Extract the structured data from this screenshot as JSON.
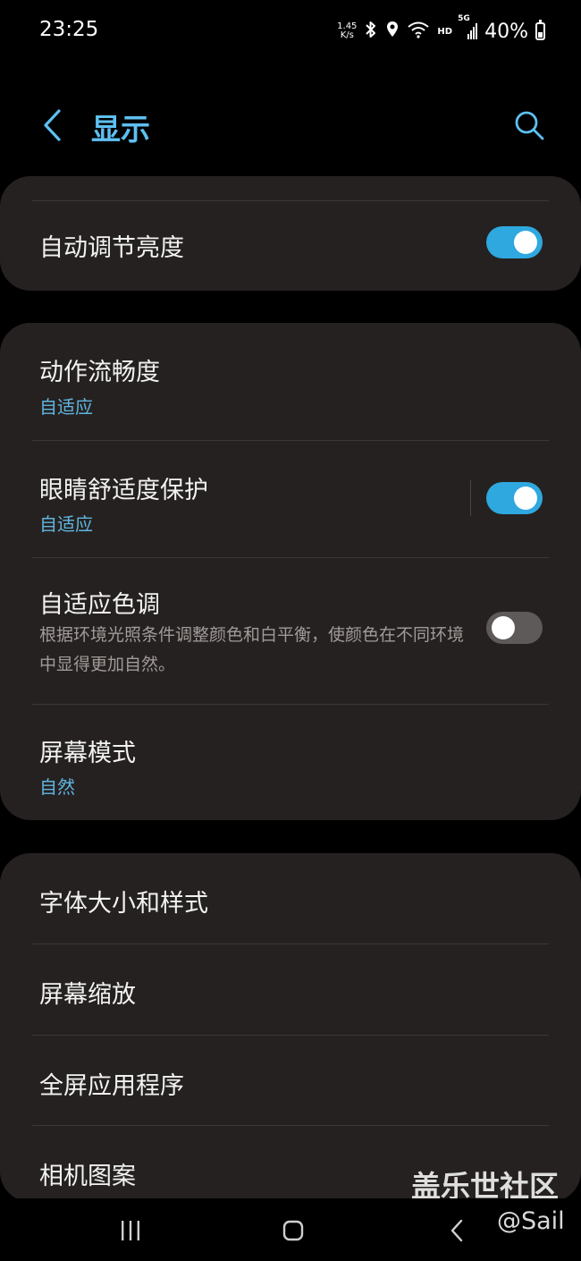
{
  "status_bar": {
    "time": "23:25",
    "net_speed_value": "1.45",
    "net_speed_unit": "K/s",
    "hd_label": "HD",
    "network_label": "5G",
    "battery_percent": "40%",
    "battery_level": 0.4,
    "icons": [
      "bluetooth-icon",
      "location-icon",
      "wifi-icon",
      "signal-icon",
      "battery-icon"
    ]
  },
  "header": {
    "title": "显示",
    "back_icon": "chevron-left-icon",
    "search_icon": "search-icon"
  },
  "card1": {
    "auto_brightness": {
      "label": "自动调节亮度",
      "enabled": true
    }
  },
  "card2": {
    "motion_smoothness": {
      "label": "动作流畅度",
      "value": "自适应"
    },
    "eye_comfort": {
      "label": "眼睛舒适度保护",
      "value": "自适应",
      "enabled": true
    },
    "adaptive_color": {
      "label": "自适应色调",
      "description": "根据环境光照条件调整颜色和白平衡，使颜色在不同环境中显得更加自然。",
      "enabled": false
    },
    "screen_mode": {
      "label": "屏幕模式",
      "value": "自然"
    }
  },
  "card3": {
    "items": [
      {
        "label": "字体大小和样式"
      },
      {
        "label": "屏幕缩放"
      },
      {
        "label": "全屏应用程序"
      },
      {
        "label": "相机图案"
      }
    ]
  },
  "navbar": {
    "icons": [
      "recent-apps-icon",
      "home-icon",
      "back-icon"
    ]
  },
  "watermark": {
    "site": "盖乐世社区",
    "handle": "@Sail"
  },
  "colors": {
    "accent": "#5ec0f2",
    "toggle_on": "#2ea8de",
    "card_bg": "#252120",
    "background": "#000000"
  }
}
